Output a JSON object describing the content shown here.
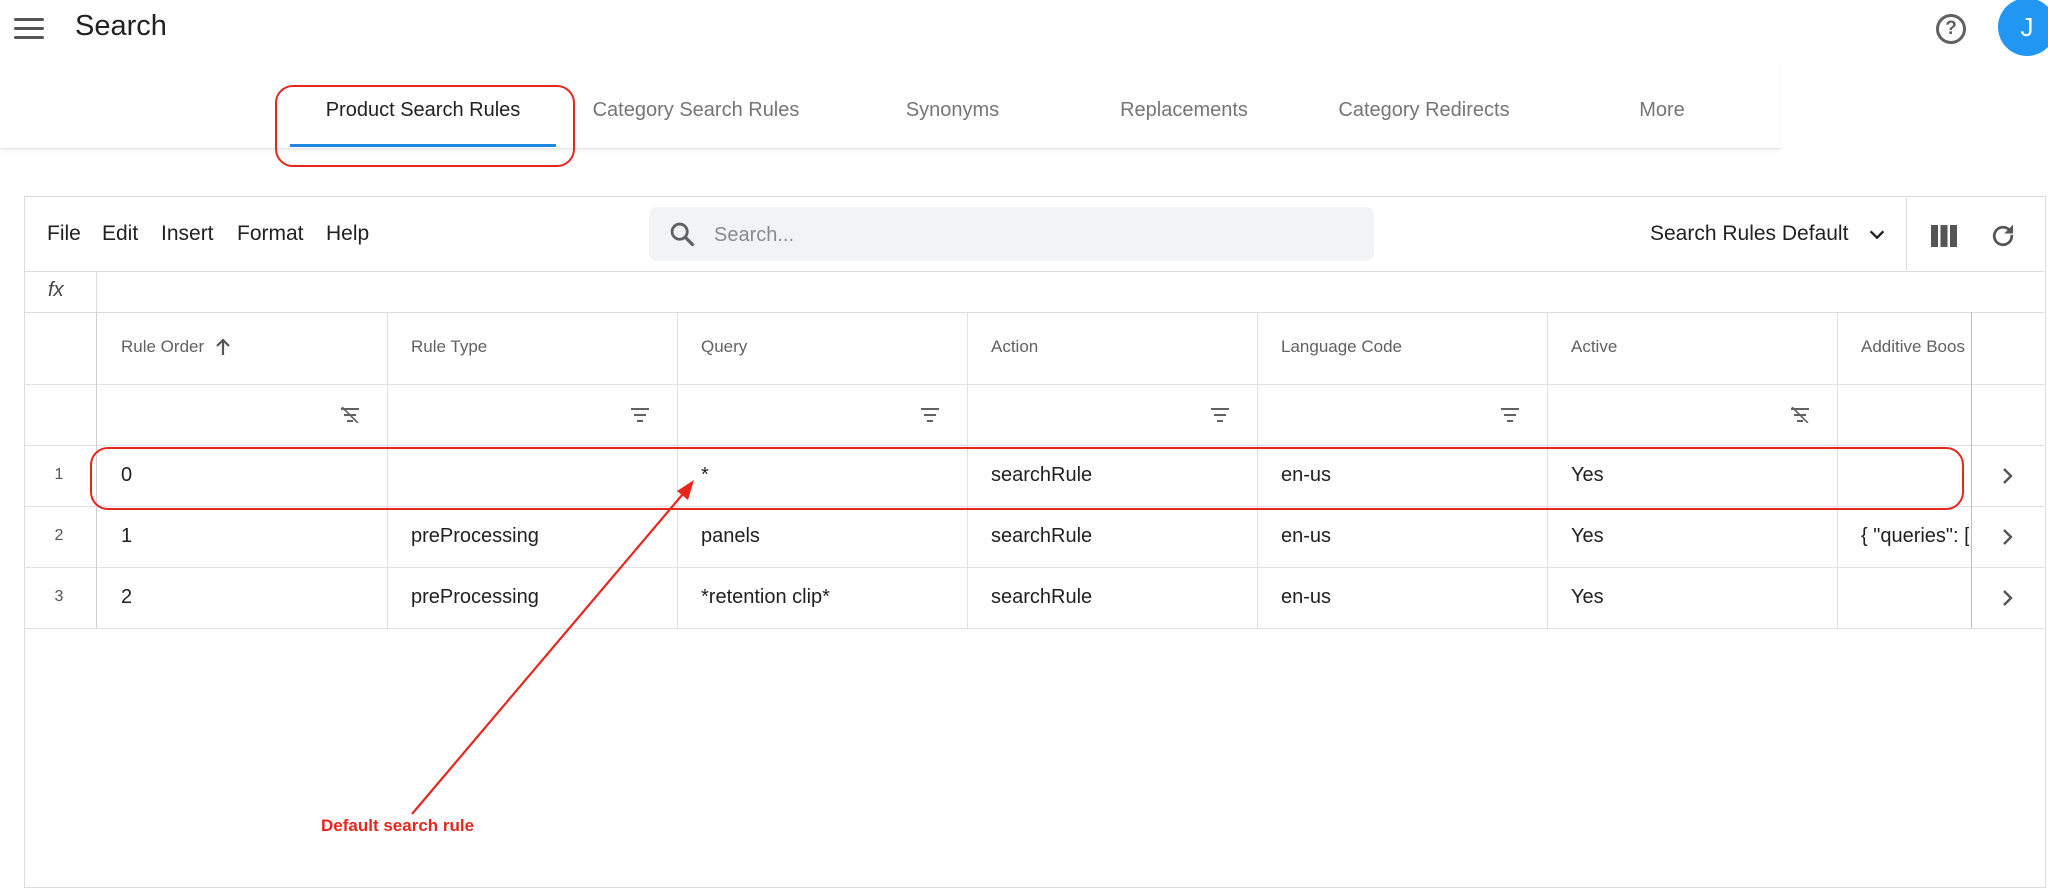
{
  "header": {
    "title": "Search",
    "help_icon": "help-circle-icon",
    "avatar_initial": "J",
    "avatar_color": "#2196f3"
  },
  "tabs": [
    {
      "label": "Product Search Rules",
      "active": true
    },
    {
      "label": "Category Search Rules"
    },
    {
      "label": "Synonyms"
    },
    {
      "label": "Replacements"
    },
    {
      "label": "Category Redirects"
    },
    {
      "label": "More"
    }
  ],
  "toolbar": {
    "menus": [
      "File",
      "Edit",
      "Insert",
      "Format",
      "Help"
    ],
    "search_placeholder": "Search...",
    "view_select": "Search Rules Default"
  },
  "formula_bar": {
    "label": "fx"
  },
  "table": {
    "columns": [
      "Rule Order",
      "Rule Type",
      "Query",
      "Action",
      "Language Code",
      "Active",
      "Additive Boos"
    ],
    "sort": {
      "column": "Rule Order",
      "direction": "ascending"
    },
    "rows": [
      {
        "num": "1",
        "cells": [
          "0",
          "",
          "*",
          "searchRule",
          "en-us",
          "Yes",
          ""
        ]
      },
      {
        "num": "2",
        "cells": [
          "1",
          "preProcessing",
          "panels",
          "searchRule",
          "en-us",
          "Yes",
          "{ \"queries\": ["
        ]
      },
      {
        "num": "3",
        "cells": [
          "2",
          "preProcessing",
          "*retention clip*",
          "searchRule",
          "en-us",
          "Yes",
          ""
        ]
      }
    ]
  },
  "annotation": {
    "text": "Default search rule",
    "color": "#e8261e"
  }
}
